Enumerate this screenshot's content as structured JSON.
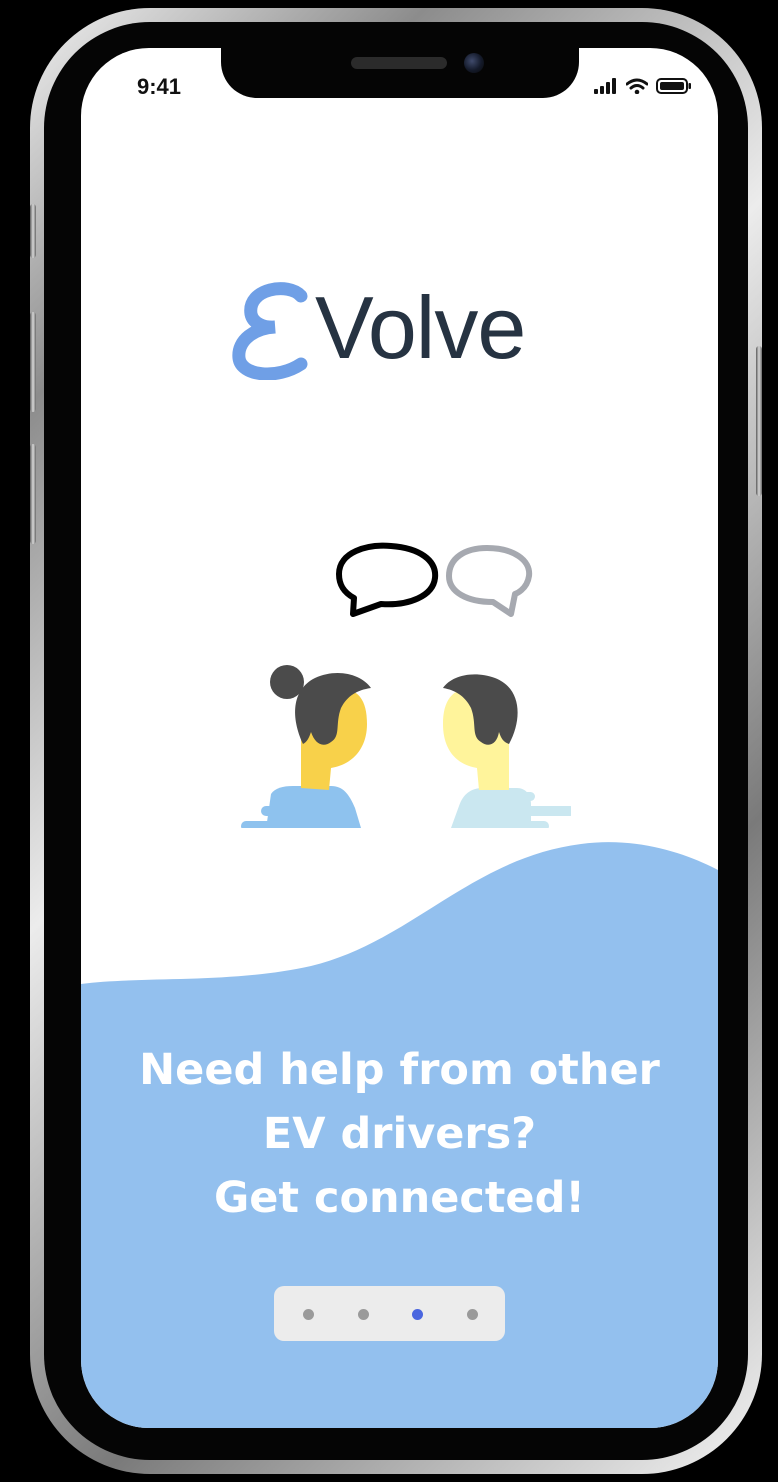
{
  "status_bar": {
    "time": "9:41",
    "icons": [
      "signal-icon",
      "wifi-icon",
      "battery-icon"
    ]
  },
  "logo": {
    "mark": "ℰ",
    "text": "Volve",
    "mark_color": "#6f9fe6",
    "text_color": "#263342"
  },
  "illustration": {
    "name": "two-people-chatting",
    "speech_bubble_left_color": "#000000",
    "speech_bubble_right_color": "#a6a9b0"
  },
  "onboarding": {
    "lines": [
      "Need help from other",
      "EV drivers?",
      "Get connected!"
    ],
    "background_color": "#93c0ee"
  },
  "pager": {
    "total": 4,
    "active_index": 2,
    "active_color": "#4a66df",
    "inactive_color": "#9a9a9a"
  }
}
